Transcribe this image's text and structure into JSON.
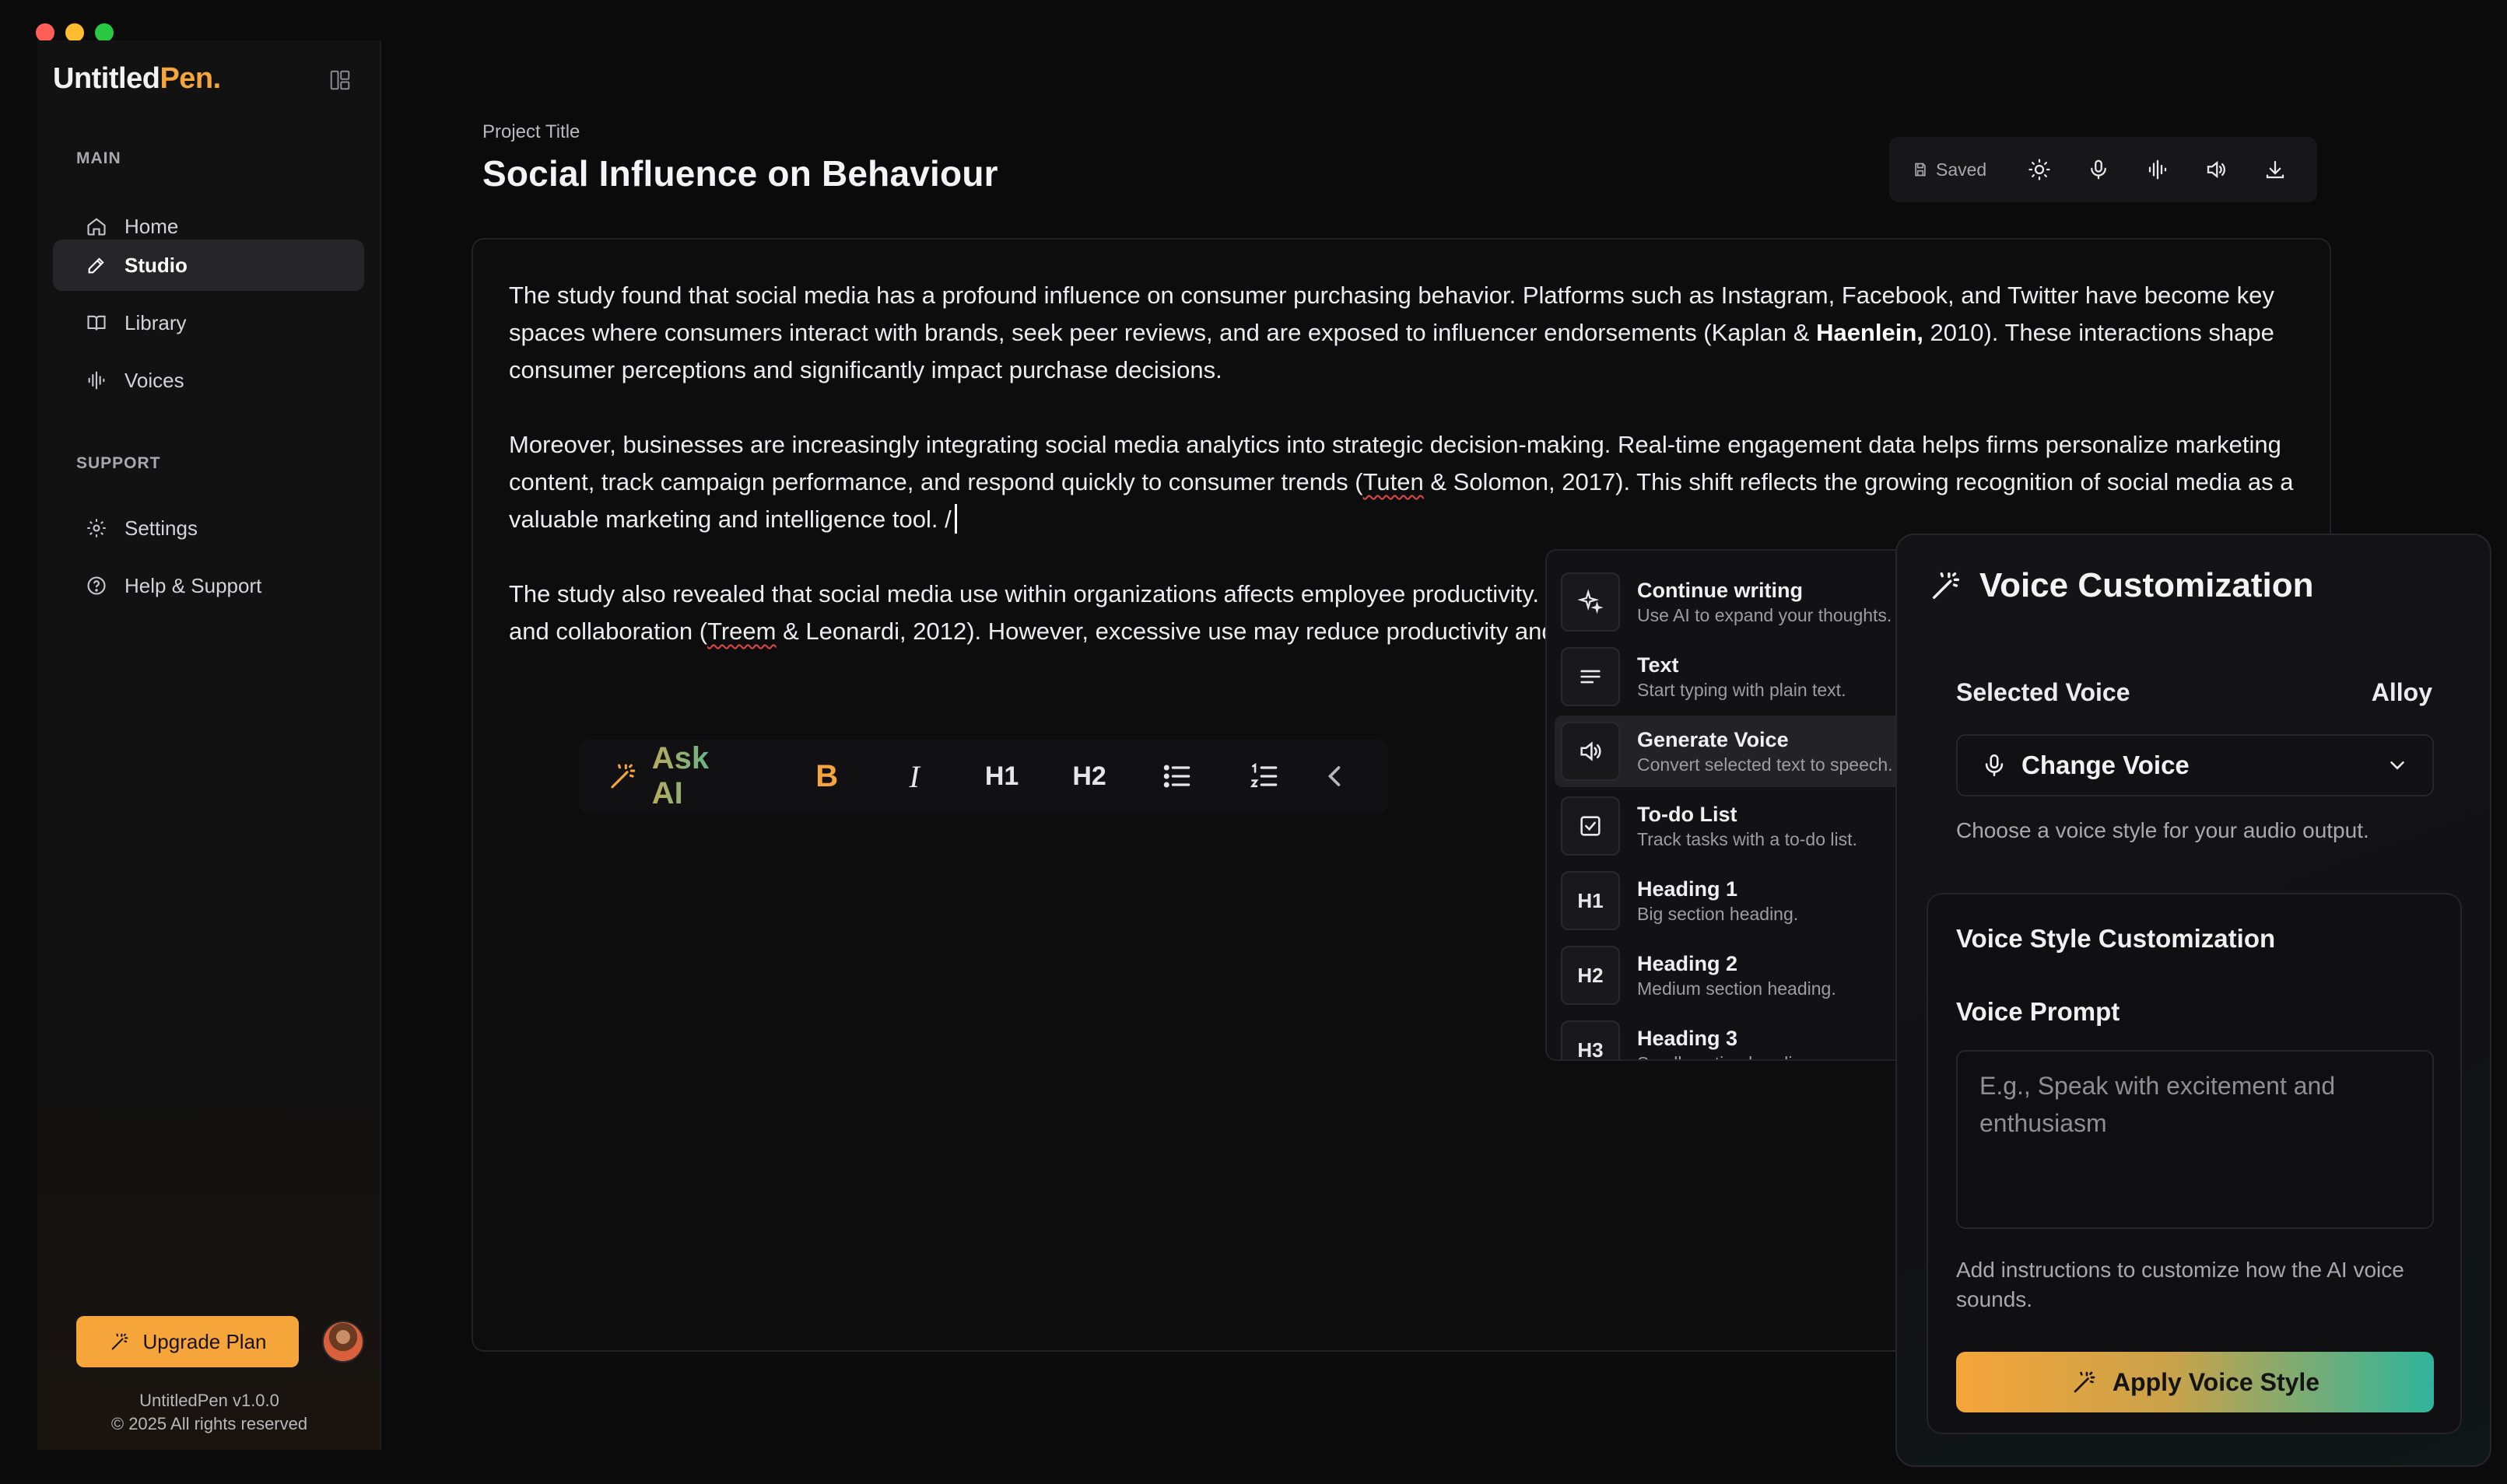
{
  "window": {
    "controls": [
      "close",
      "minimize",
      "maximize"
    ]
  },
  "sidebar": {
    "logo": {
      "part1": "Untitled",
      "part2": "Pen."
    },
    "section_main": "MAIN",
    "main_items": [
      {
        "label": "Home",
        "icon": "home-icon"
      },
      {
        "label": "Studio",
        "icon": "pen-icon",
        "active": true
      },
      {
        "label": "Library",
        "icon": "book-icon"
      },
      {
        "label": "Voices",
        "icon": "waveform-icon"
      }
    ],
    "section_support": "SUPPORT",
    "support_items": [
      {
        "label": "Settings",
        "icon": "gear-icon"
      },
      {
        "label": "Help & Support",
        "icon": "help-icon"
      }
    ],
    "upgrade_label": "Upgrade Plan",
    "version": "UntitledPen v1.0.0",
    "copyright": "© 2025 All rights reserved"
  },
  "header": {
    "project_label": "Project Title",
    "title": "Social Influence on Behaviour",
    "saved_label": "Saved"
  },
  "editor": {
    "p1_a": "The study found that social media has a profound influence on consumer purchasing behavior. Platforms such as Instagram, Facebook, and Twitter have become key spaces where consumers interact with brands, seek peer reviews, and are exposed to influencer endorsements (Kaplan & ",
    "p1_bold": "Haenlein,",
    "p1_b": " 2010). These interactions shape consumer perceptions and significantly impact purchase decisions.",
    "p2_a": "Moreover, businesses are increasingly integrating social media analytics into strategic decision-making. Real-time engagement data helps firms personalize marketing content, track campaign performance, and respond quickly to consumer trends (",
    "p2_squiggle": "Tuten",
    "p2_b": " & Solomon, 2017). This shift reflects the growing recognition of social media as a valuable marketing and intelligence tool.  /",
    "p3_a": "The study also revealed that social media use within organizations affects employee productivity. On one hand, it promotes internal communication, knowledge sharing, and collaboration (",
    "p3_squiggle": "Treem",
    "p3_b": " & Leonardi, 2012). However, excessive use may reduce productivity and blur the boundaries between professional and personal life."
  },
  "format_bar": {
    "ask_ai": "Ask AI",
    "bold": "B",
    "italic": "I",
    "h1": "H1",
    "h2": "H2"
  },
  "slash_menu": {
    "items": [
      {
        "title": "Continue writing",
        "desc": "Use AI to expand your thoughts.",
        "icon": "sparkle-icon"
      },
      {
        "title": "Text",
        "desc": "Start typing with plain text.",
        "icon": "text-lines-icon"
      },
      {
        "title": "Generate Voice",
        "desc": "Convert selected text to speech.",
        "icon": "speaker-icon",
        "active": true
      },
      {
        "title": "To-do List",
        "desc": "Track tasks with a to-do list.",
        "icon": "checkbox-icon"
      },
      {
        "title": "Heading 1",
        "desc": "Big section heading.",
        "icon_text": "H1"
      },
      {
        "title": "Heading 2",
        "desc": "Medium section heading.",
        "icon_text": "H2"
      },
      {
        "title": "Heading 3",
        "desc": "Small section heading.",
        "icon_text": "H3"
      }
    ]
  },
  "voice_panel": {
    "title": "Voice Customization",
    "selected_label": "Selected Voice",
    "selected_value": "Alloy",
    "change_voice": "Change Voice",
    "help": "Choose a voice style for your audio output.",
    "style_title": "Voice Style Customization",
    "prompt_label": "Voice Prompt",
    "prompt_placeholder": "E.g., Speak with excitement and enthusiasm",
    "prompt_value": "",
    "instructions": "Add instructions to customize how the AI voice sounds.",
    "apply_label": "Apply Voice Style"
  },
  "colors": {
    "accent_orange": "#f5a53a",
    "accent_teal": "#2fb59c",
    "background": "#0b0b0c"
  }
}
